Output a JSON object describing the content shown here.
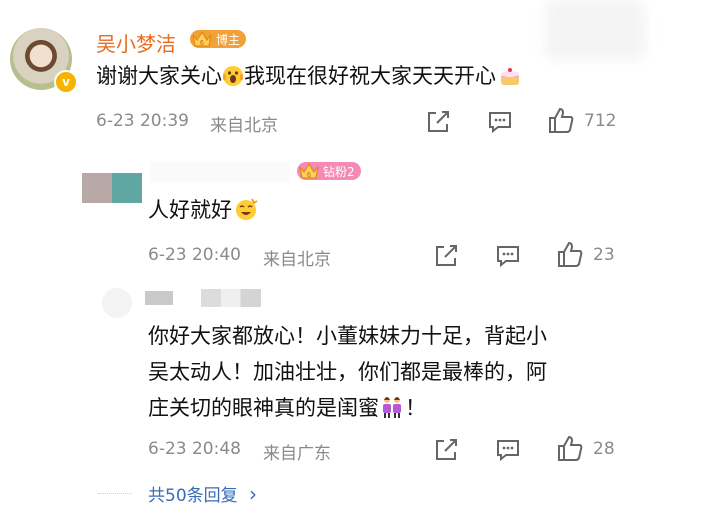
{
  "main_comment": {
    "username": "吴小梦洁",
    "badge": "博主",
    "text_parts": [
      "谢谢大家关心",
      "我现在很好祝大家天天开心"
    ],
    "time": "6-23 20:39",
    "location": "来自北京",
    "like_count": "712"
  },
  "reply_1": {
    "badge": "钻粉2",
    "text": "人好就好",
    "time": "6-23 20:40",
    "location": "来自北京",
    "like_count": "23"
  },
  "reply_2": {
    "lines": [
      "你好大家都放心！小董妹妹力十足，背起小",
      "吴太动人！加油壮壮，你们都是最棒的，阿",
      "庄关切的眼神真的是闺蜜"
    ],
    "line3_end": "！",
    "time": "6-23 20:48",
    "location": "来自广东",
    "like_count": "28"
  },
  "footer": {
    "replies_label": "共50条回复",
    "chevron": "›"
  },
  "icons": {
    "verified": "verified-badge-icon",
    "crown": "crown-level-icon",
    "emoji_scream": "scream-emoji-icon",
    "emoji_cake": "cake-emoji-icon",
    "emoji_happy": "happy-emoji-icon",
    "emoji_girls": "two-women-emoji-icon"
  },
  "colors": {
    "username": "#e86b1f",
    "meta": "#8a8a8a",
    "link": "#3a6bb5",
    "badge_orange": "#f2a13a",
    "badge_pink": "#f58ab5"
  }
}
